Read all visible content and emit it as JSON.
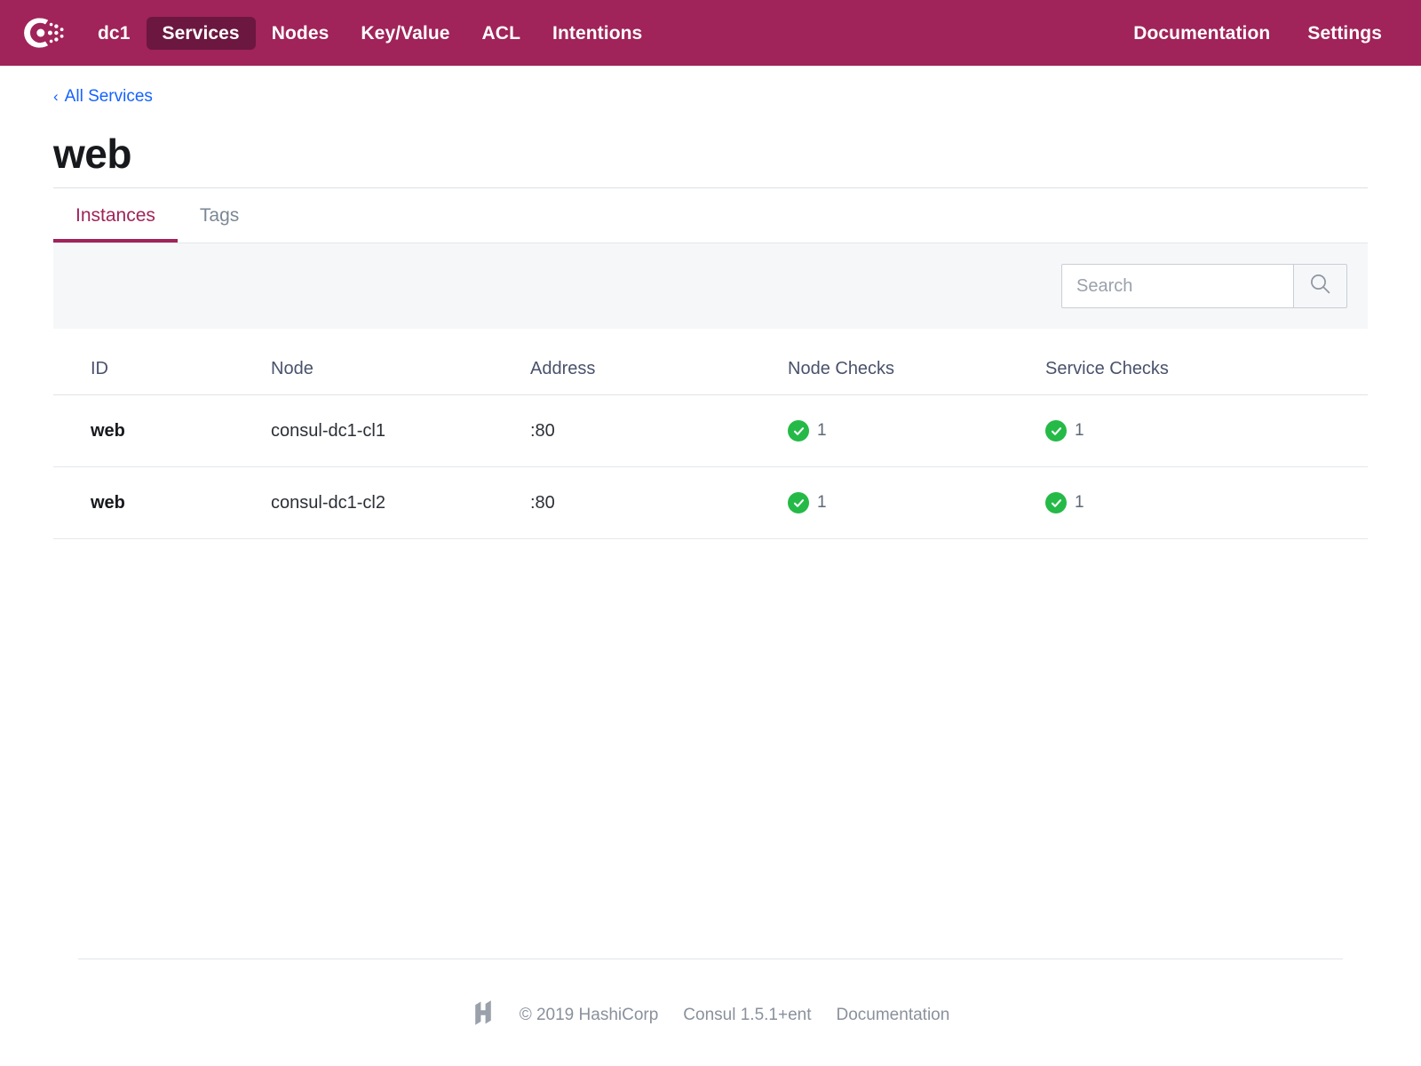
{
  "navbar": {
    "logo_icon": "consul-logo-icon",
    "datacenter": "dc1",
    "items": [
      {
        "label": "Services",
        "active": true
      },
      {
        "label": "Nodes",
        "active": false
      },
      {
        "label": "Key/Value",
        "active": false
      },
      {
        "label": "ACL",
        "active": false
      },
      {
        "label": "Intentions",
        "active": false
      }
    ],
    "right_items": [
      {
        "label": "Documentation"
      },
      {
        "label": "Settings"
      }
    ],
    "background_color": "#a02359",
    "active_background_color": "#6b1740"
  },
  "breadcrumb": {
    "chevron": "‹",
    "label": "All Services",
    "color": "#1563ff"
  },
  "page_title": "web",
  "tabs": [
    {
      "label": "Instances",
      "active": true
    },
    {
      "label": "Tags",
      "active": false
    }
  ],
  "toolbar": {
    "search_placeholder": "Search",
    "search_value": "",
    "search_icon": "search-icon"
  },
  "table": {
    "columns": [
      "ID",
      "Node",
      "Address",
      "Node Checks",
      "Service Checks"
    ],
    "rows": [
      {
        "id": "web",
        "node": "consul-dc1-cl1",
        "address": ":80",
        "node_checks": "1",
        "service_checks": "1",
        "node_checks_status": "passing",
        "service_checks_status": "passing"
      },
      {
        "id": "web",
        "node": "consul-dc1-cl2",
        "address": ":80",
        "node_checks": "1",
        "service_checks": "1",
        "node_checks_status": "passing",
        "service_checks_status": "passing"
      }
    ],
    "status_color": "#25ba47"
  },
  "footer": {
    "logo_icon": "hashicorp-logo-icon",
    "copyright": "© 2019 HashiCorp",
    "version": "Consul 1.5.1+ent",
    "documentation": "Documentation"
  }
}
